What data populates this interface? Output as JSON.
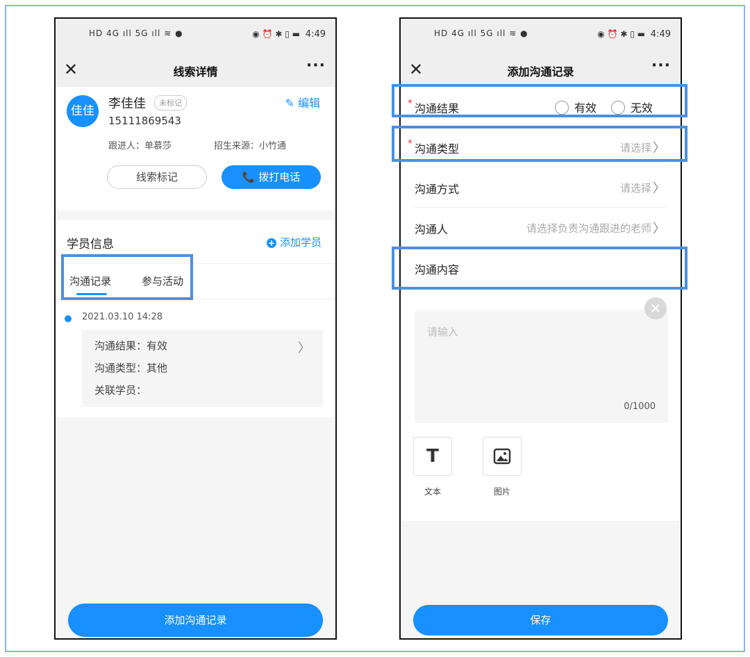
{
  "status": {
    "left_icons": "HD 4G ıll 5G ıll ≋ ●",
    "right_icons": "◉ ⏰ ✱ ▯ ▬",
    "time": "4:49"
  },
  "left": {
    "nav_title": "线索详情",
    "lead": {
      "avatar_text": "佳佳",
      "name": "李佳佳",
      "tag": "未标记",
      "phone": "15111869543",
      "edit_label": "编辑",
      "follower": "跟进人：单慕莎",
      "source": "招生来源：小竹通",
      "mark_button": "线索标记",
      "call_button": "拨打电话"
    },
    "student_section": {
      "title": "学员信息",
      "add_label": "添加学员"
    },
    "tabs": [
      {
        "label": "沟通记录"
      },
      {
        "label": "参与活动"
      }
    ],
    "record": {
      "time": "2021.03.10 14:28",
      "result": "沟通结果：有效",
      "type": "沟通类型：其他",
      "student": "关联学员："
    },
    "bottom_button": "添加沟通记录"
  },
  "right": {
    "nav_title": "添加沟通记录",
    "fields": {
      "result": {
        "label": "沟通结果",
        "options": [
          "有效",
          "无效"
        ]
      },
      "type": {
        "label": "沟通类型",
        "value": "请选择"
      },
      "method": {
        "label": "沟通方式",
        "value": "请选择"
      },
      "person": {
        "label": "沟通人",
        "value": "请选择负责沟通跟进的老师"
      },
      "content": {
        "label": "沟通内容"
      }
    },
    "textarea": {
      "placeholder": "请输入",
      "count": "0/1000"
    },
    "tools": [
      {
        "label": "文本"
      },
      {
        "label": "图片"
      }
    ],
    "save_button": "保存"
  },
  "highlight_color": "#4a90e2",
  "accent": "#1890ff"
}
